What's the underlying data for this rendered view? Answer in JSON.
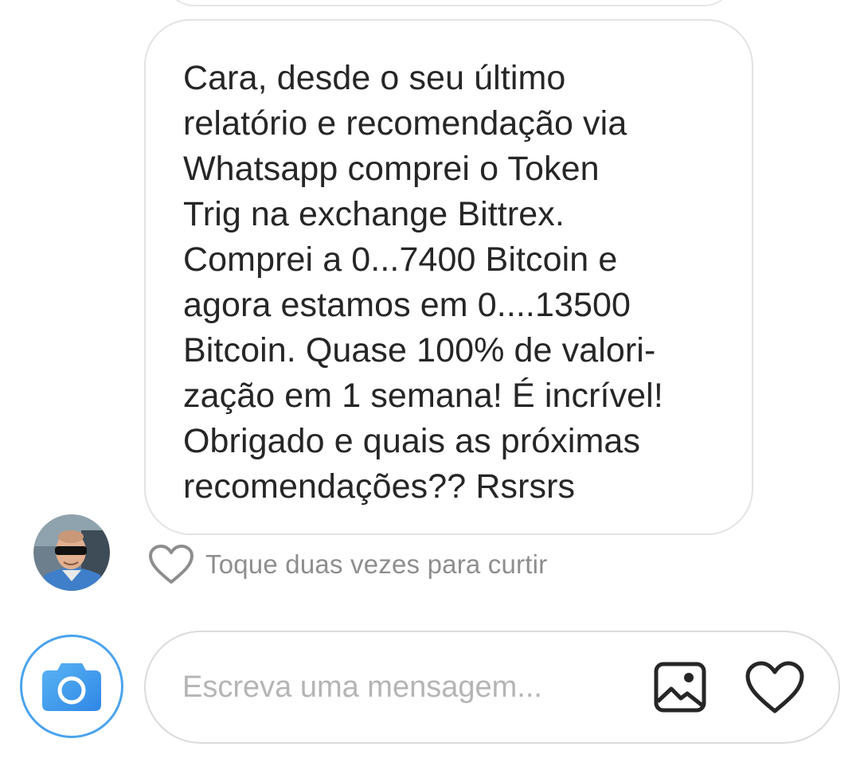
{
  "message": {
    "text": "Cara, desde o seu último\nrelatório e recomendação via\nWhatsapp comprei o Token\nTrig na exchange Bittrex.\nComprei a 0...7400 Bitcoin e\nagora estamos em 0....13500\nBitcoin. Quase  100% de valori-\nzação em 1 semana! É incrível!\nObrigado e quais as próximas\nrecomendações?? Rsrsrs"
  },
  "like_hint": {
    "label": "Toque duas vezes para curtir",
    "icon": "heart-outline-icon"
  },
  "sender": {
    "avatar_icon": "user-avatar"
  },
  "composer": {
    "placeholder": "Escreva uma mensagem...",
    "value": "",
    "camera_icon": "camera-icon",
    "gallery_icon": "image-icon",
    "like_icon": "heart-icon"
  },
  "colors": {
    "accent": "#3897f0",
    "text": "#262626",
    "muted": "#8e8e8e",
    "border": "#dbdbdb"
  }
}
